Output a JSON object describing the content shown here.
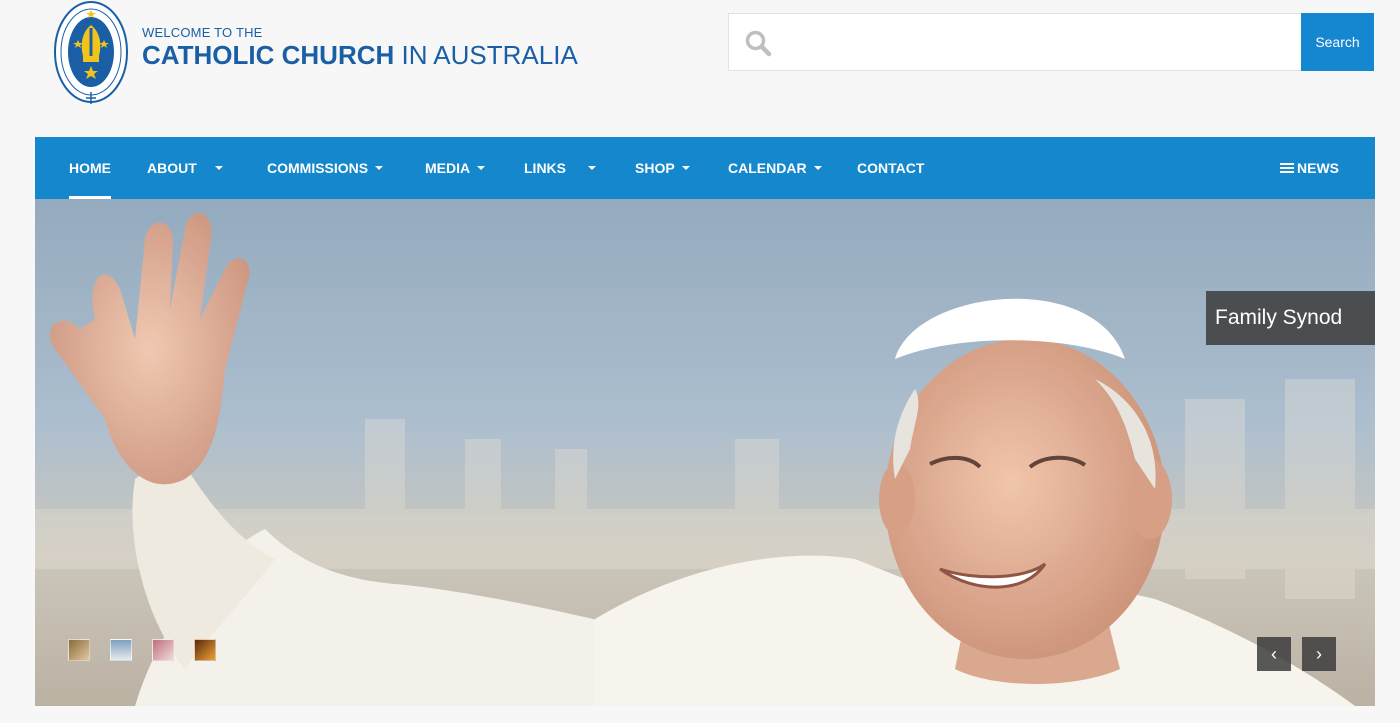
{
  "brand": {
    "line1": "WELCOME TO THE",
    "line2_strong": "CATHOLIC CHURCH",
    "line2_light": "IN AUSTRALIA",
    "seal_text": "AUSTRALIAN CATHOLIC BISHOPS CONFERENCE",
    "color": "#1a5fa6"
  },
  "search": {
    "placeholder": "",
    "value": "",
    "button_label": "Search",
    "icon": "search-icon"
  },
  "nav": {
    "items": [
      {
        "label": "HOME",
        "active": true,
        "dropdown": false
      },
      {
        "label": "ABOUT",
        "active": false,
        "dropdown": true
      },
      {
        "label": "COMMISSIONS",
        "active": false,
        "dropdown": true
      },
      {
        "label": "MEDIA",
        "active": false,
        "dropdown": true
      },
      {
        "label": "LINKS",
        "active": false,
        "dropdown": true
      },
      {
        "label": "SHOP",
        "active": false,
        "dropdown": true
      },
      {
        "label": "CALENDAR",
        "active": false,
        "dropdown": true
      },
      {
        "label": "CONTACT",
        "active": false,
        "dropdown": false
      }
    ],
    "news_label": "NEWS",
    "background": "#1587cd"
  },
  "slider": {
    "caption": "Family Synod",
    "thumbnails": [
      "thumbnail-1",
      "thumbnail-2",
      "thumbnail-3",
      "thumbnail-4"
    ],
    "prev_icon": "chevron-left-icon",
    "next_icon": "chevron-right-icon",
    "prev_glyph": "‹",
    "next_glyph": "›"
  }
}
